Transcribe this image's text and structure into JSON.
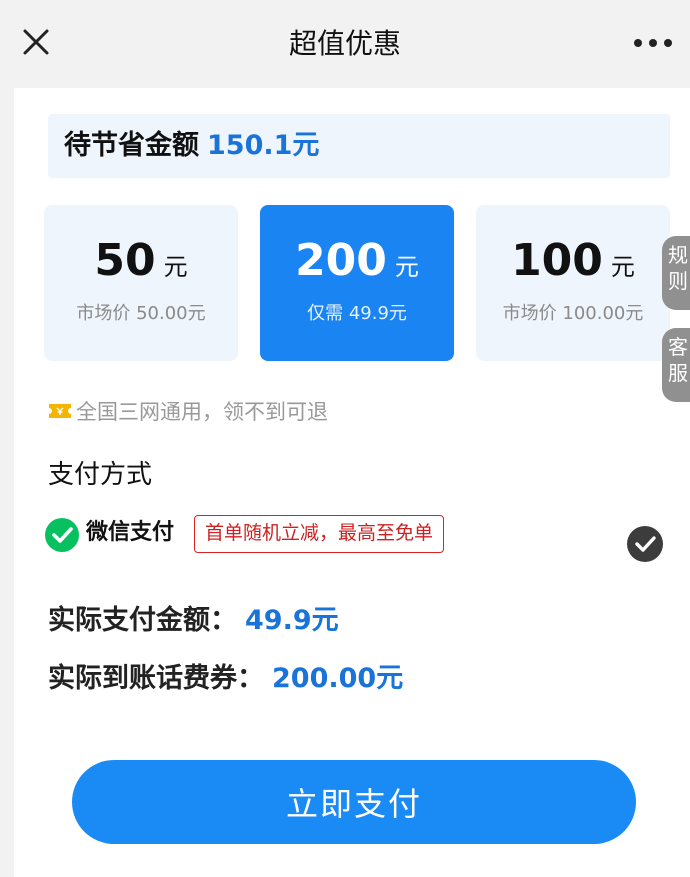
{
  "header": {
    "title": "超值优惠"
  },
  "savings": {
    "label": "待节省金额",
    "amount": "150.1元"
  },
  "cards": [
    {
      "amount": "50",
      "unit": "元",
      "sub": "市场价 50.00元",
      "selected": false
    },
    {
      "amount": "200",
      "unit": "元",
      "sub": "仅需 49.9元",
      "selected": true
    },
    {
      "amount": "100",
      "unit": "元",
      "sub": "市场价 100.00元",
      "selected": false
    }
  ],
  "side_tabs": {
    "rules": "规则",
    "service": "客服"
  },
  "notice": "全国三网通用，领不到可退",
  "payment": {
    "heading": "支付方式",
    "method": "微信支付",
    "promo": "首单随机立减，最高至免单"
  },
  "summary": {
    "pay_label": "实际支付金额：",
    "pay_value": "49.9元",
    "voucher_label": "实际到账话费券：",
    "voucher_value": "200.00元"
  },
  "pay_button_label": "立即支付",
  "colors": {
    "accent": "#1a84f2",
    "highlight_text": "#1a73d9",
    "promo_red": "#cc2222",
    "wechat_green": "#07c160"
  }
}
